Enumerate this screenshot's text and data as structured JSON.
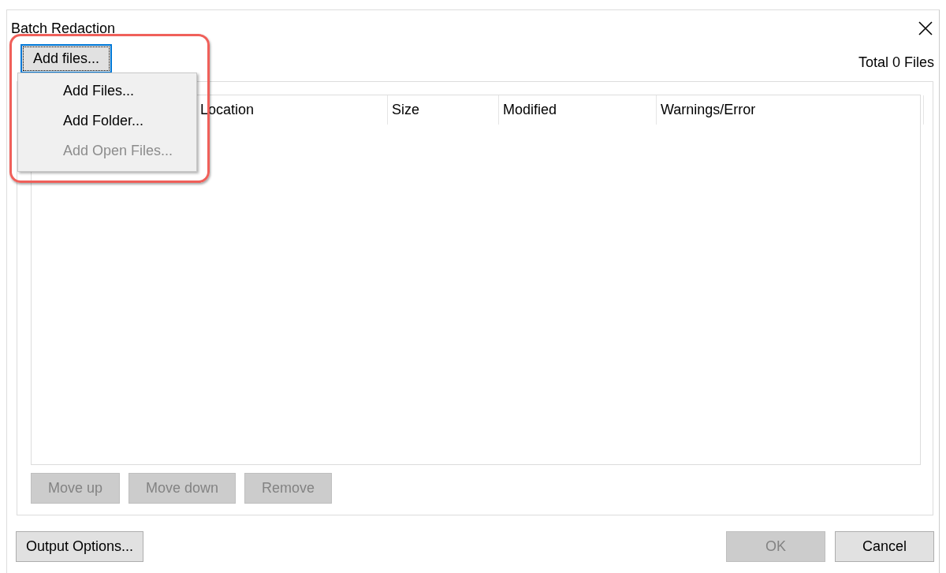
{
  "window": {
    "title": "Batch Redaction"
  },
  "add_button": {
    "label": "Add files...",
    "focused": true
  },
  "total": "Total 0 Files",
  "menu": [
    {
      "label": "Add Files...",
      "disabled": false
    },
    {
      "label": "Add Folder...",
      "disabled": false
    },
    {
      "label": "Add Open Files...",
      "disabled": true
    }
  ],
  "table": {
    "columns": [
      "Location",
      "Size",
      "Modified",
      "Warnings/Error"
    ]
  },
  "list_buttons": [
    {
      "label": "Move up",
      "disabled": true
    },
    {
      "label": "Move down",
      "disabled": true
    },
    {
      "label": "Remove",
      "disabled": true
    }
  ],
  "output_button": {
    "label": "Output Options...",
    "disabled": false
  },
  "buttons": [
    {
      "label": "OK",
      "disabled": true
    },
    {
      "label": "Cancel",
      "disabled": false
    }
  ]
}
